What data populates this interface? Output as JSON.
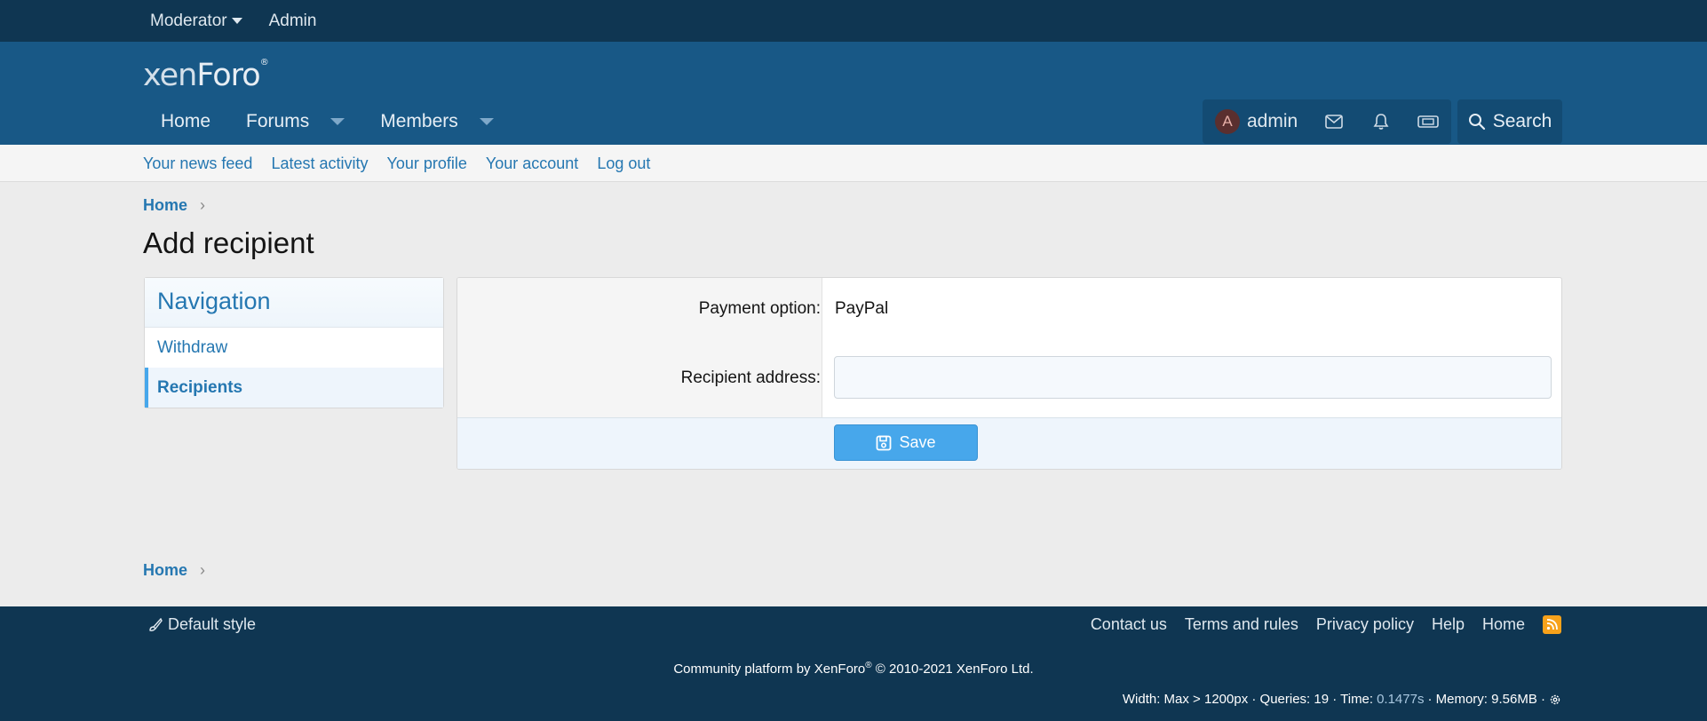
{
  "staff_bar": {
    "moderator": "Moderator",
    "admin": "Admin"
  },
  "header": {
    "logo": {
      "main": "xen",
      "rest": "Foro",
      "mark": "®"
    },
    "tabs": [
      {
        "label": "Home"
      },
      {
        "label": "Forums"
      },
      {
        "label": "Members"
      }
    ],
    "account": {
      "avatar_letter": "A",
      "username": "admin"
    },
    "search_label": "Search"
  },
  "subnav": [
    "Your news feed",
    "Latest activity",
    "Your profile",
    "Your account",
    "Log out"
  ],
  "breadcrumb": {
    "top": "Home",
    "bottom": "Home"
  },
  "page_title": "Add recipient",
  "navigation": {
    "title": "Navigation",
    "items": [
      {
        "label": "Withdraw"
      },
      {
        "label": "Recipients"
      }
    ]
  },
  "form": {
    "payment_label": "Payment option:",
    "payment_value": "PayPal",
    "recipient_label": "Recipient address:",
    "recipient_value": "",
    "save_label": "Save"
  },
  "footer": {
    "style": "Default style",
    "links": [
      "Contact us",
      "Terms and rules",
      "Privacy policy",
      "Help",
      "Home"
    ],
    "copyright_prefix": "Community platform by XenForo",
    "copyright_mark": "®",
    "copyright_suffix": " © 2010-2021 XenForo Ltd.",
    "debug_prefix": "Width: Max > 1200px · Queries: 19 · Time: ",
    "debug_time": "0.1477s",
    "debug_suffix": " · Memory: 9.56MB ·"
  }
}
